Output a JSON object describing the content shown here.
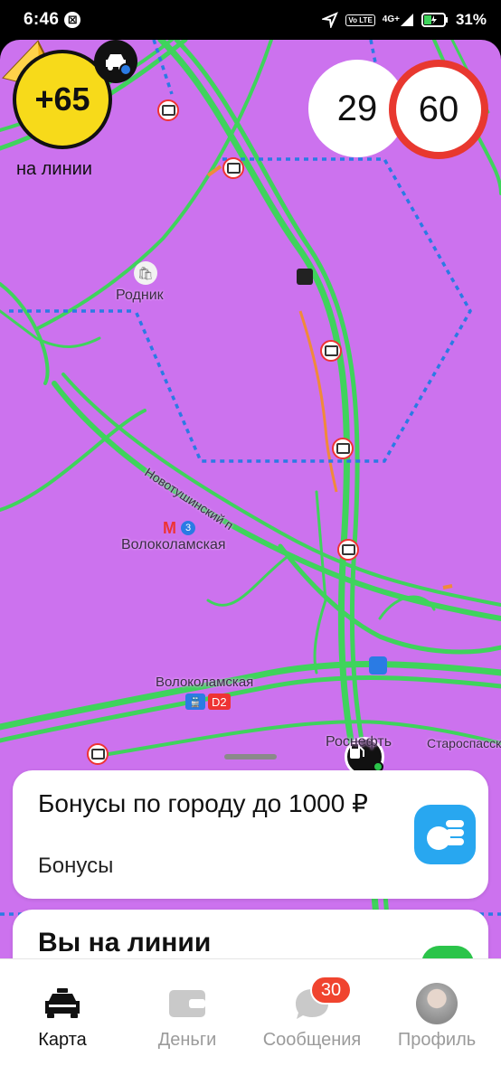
{
  "status_bar": {
    "time": "6:46",
    "network": "4G+",
    "volte": "Vo LTE",
    "battery": "31%"
  },
  "driver": {
    "score": "+65",
    "status": "на линии"
  },
  "speed": {
    "current": "29",
    "limit": "60"
  },
  "map": {
    "labels": {
      "rodnik": "Родник",
      "street": "Новотушинский п",
      "metro_line": "3",
      "metro_station": "Волоколамская",
      "train_station": "Волоколамская",
      "train_line": "D2",
      "rosneft": "Роснефть",
      "starospassk": "Староспасск"
    },
    "colors": {
      "background": "#cc72ee",
      "roads": "#3fd35c",
      "zone_border": "#2a7be4",
      "jam": "#f08a3a"
    }
  },
  "cards": {
    "bonus": {
      "title": "Бонусы по городу до 1000 ₽",
      "subtitle": "Бонусы"
    },
    "online": {
      "title": "Вы на линии"
    }
  },
  "tabs": [
    {
      "label": "Карта",
      "icon": "car-icon",
      "active": true
    },
    {
      "label": "Деньги",
      "icon": "wallet-icon"
    },
    {
      "label": "Сообщения",
      "icon": "chat-icon",
      "badge": "30"
    },
    {
      "label": "Профиль",
      "icon": "avatar"
    }
  ]
}
